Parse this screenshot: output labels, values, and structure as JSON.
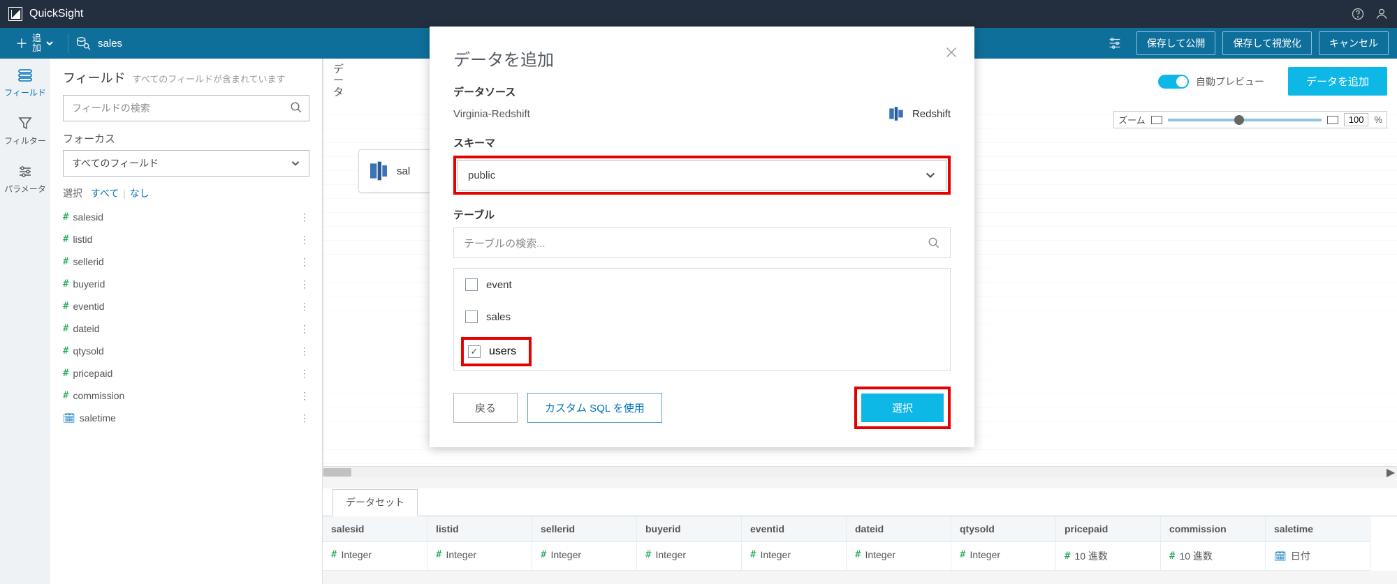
{
  "brand": "QuickSight",
  "toolbar": {
    "add_label": "追\n加",
    "dataset_name": "sales",
    "save_publish": "保存して公開",
    "save_visualize": "保存して視覚化",
    "cancel": "キャンセル"
  },
  "rail": {
    "fields": "フィールド",
    "filters": "フィルター",
    "parameters": "パラメータ"
  },
  "fields": {
    "title": "フィールド",
    "subtitle": "すべてのフィールドが含まれています",
    "search_placeholder": "フィールドの検索",
    "focus_label": "フォーカス",
    "focus_value": "すべてのフィールド",
    "select_label": "選択",
    "select_all": "すべて",
    "select_none": "なし",
    "items": [
      "salesid",
      "listid",
      "sellerid",
      "buyerid",
      "eventid",
      "dateid",
      "qtysold",
      "pricepaid",
      "commission"
    ],
    "date_item": "saletime"
  },
  "canvas": {
    "data_label": "データ",
    "auto_preview": "自動プレビュー",
    "add_data": "データを追加",
    "zoom_label": "ズーム",
    "zoom_value": "100",
    "zoom_pct": "%",
    "node_label": "sal"
  },
  "bottom": {
    "tab": "データセット",
    "cols": [
      {
        "h": "salesid",
        "t": "Integer",
        "k": "n"
      },
      {
        "h": "listid",
        "t": "Integer",
        "k": "n"
      },
      {
        "h": "sellerid",
        "t": "Integer",
        "k": "n"
      },
      {
        "h": "buyerid",
        "t": "Integer",
        "k": "n"
      },
      {
        "h": "eventid",
        "t": "Integer",
        "k": "n"
      },
      {
        "h": "dateid",
        "t": "Integer",
        "k": "n"
      },
      {
        "h": "qtysold",
        "t": "Integer",
        "k": "n"
      },
      {
        "h": "pricepaid",
        "t": "10 進数",
        "k": "n"
      },
      {
        "h": "commission",
        "t": "10 進数",
        "k": "n"
      },
      {
        "h": "saletime",
        "t": "日付",
        "k": "d"
      }
    ]
  },
  "modal": {
    "title": "データを追加",
    "datasource_label": "データソース",
    "datasource_name": "Virginia-Redshift",
    "datasource_type": "Redshift",
    "schema_label": "スキーマ",
    "schema_value": "public",
    "table_label": "テーブル",
    "table_search_placeholder": "テーブルの検索...",
    "tables": [
      {
        "name": "event",
        "checked": false
      },
      {
        "name": "sales",
        "checked": false
      },
      {
        "name": "users",
        "checked": true
      }
    ],
    "back": "戻る",
    "custom_sql": "カスタム SQL を使用",
    "select": "選択"
  }
}
